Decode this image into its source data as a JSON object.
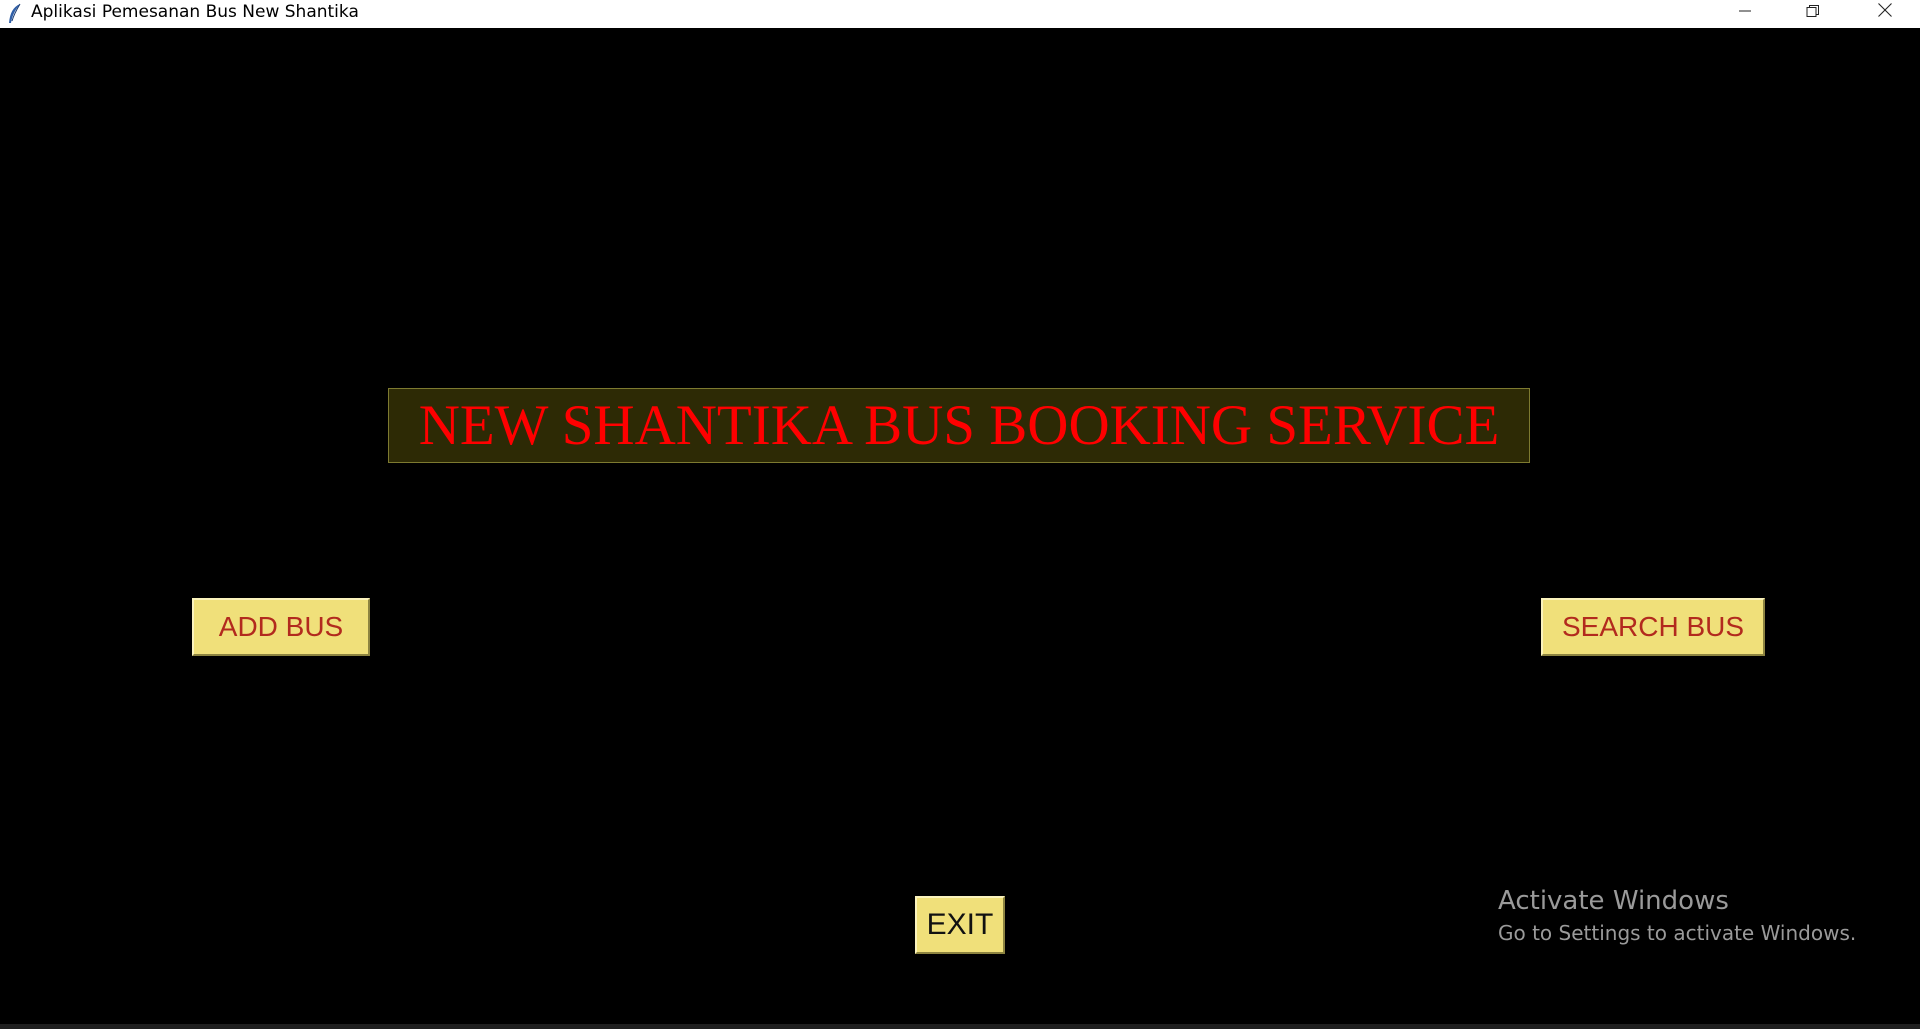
{
  "window": {
    "title": "Aplikasi Pemesanan Bus New Shantika",
    "controls": {
      "minimize_icon": "minimize-icon",
      "restore_icon": "restore-icon",
      "close_icon": "close-icon"
    }
  },
  "main": {
    "banner_text": "NEW SHANTIKA BUS BOOKING SERVICE",
    "buttons": {
      "add_bus": "ADD BUS",
      "search_bus": "SEARCH BUS",
      "exit": "EXIT"
    }
  },
  "watermark": {
    "title": "Activate Windows",
    "subtitle": "Go to Settings to activate Windows."
  },
  "colors": {
    "background": "#000000",
    "banner_bg": "#2d2a05",
    "banner_text": "#ff0000",
    "button_bg": "#f0e07a",
    "button_text": "#b22a1e"
  }
}
